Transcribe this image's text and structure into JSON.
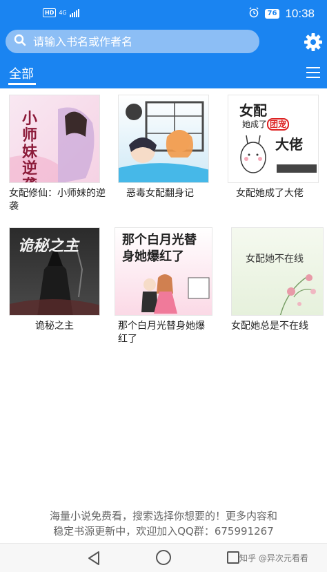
{
  "status_bar": {
    "hd": "HD",
    "network": "4G",
    "battery": "76",
    "time": "10:38"
  },
  "search": {
    "placeholder": "请输入书名或作者名"
  },
  "tabs": {
    "active": "全部"
  },
  "books": [
    {
      "title": "女配修仙：小师妹的逆袭",
      "cover_text": "小师妹逆袭",
      "cover_color": "#f7e3ef"
    },
    {
      "title": "恶毒女配翻身记",
      "cover_text": "",
      "cover_color": "#dbeef8"
    },
    {
      "title": "女配她成了大佬",
      "cover_text": "女配 她成了团宠 大佬",
      "cover_color": "#ffffff"
    },
    {
      "title": "诡秘之主",
      "cover_text": "诡秘之主",
      "cover_color": "#3a3a3a"
    },
    {
      "title": "那个白月光替身她爆红了",
      "cover_text": "那个白月光替身她爆红了",
      "cover_color": "#fde6ef"
    },
    {
      "title": "女配她总是不在线",
      "cover_text": "女配她不在线",
      "cover_color": "#f1f7ea"
    }
  ],
  "footer": {
    "line1": "海量小说免费看，搜索选择你想要的！更多内容和",
    "line2": "稳定书源更新中，欢迎加入QQ群：675991267"
  },
  "watermark": "知乎 @异次元看看",
  "colors": {
    "primary": "#1a84f1",
    "search_bg": "#8cbef5"
  }
}
